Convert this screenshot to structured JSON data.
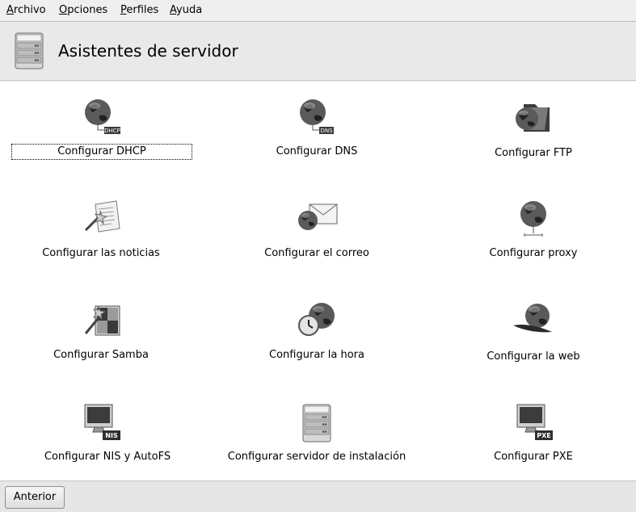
{
  "menubar": {
    "items": [
      {
        "label": "Archivo",
        "icon": null
      },
      {
        "label": "Opciones"
      },
      {
        "label": "Perfiles"
      },
      {
        "label": "Ayuda"
      }
    ]
  },
  "header": {
    "title": "Asistentes de servidor",
    "icon": "server-icon"
  },
  "wizards": [
    {
      "label": "Configurar DHCP",
      "icon": "globe-dhcp-icon",
      "focused": true
    },
    {
      "label": "Configurar DNS",
      "icon": "globe-dns-icon"
    },
    {
      "label": "Configurar FTP",
      "icon": "globe-folder-icon"
    },
    {
      "label": "Configurar las noticias",
      "icon": "news-wand-icon"
    },
    {
      "label": "Configurar el correo",
      "icon": "globe-mail-icon"
    },
    {
      "label": "Configurar proxy",
      "icon": "globe-network-icon"
    },
    {
      "label": "Configurar Samba",
      "icon": "samba-wand-icon"
    },
    {
      "label": "Configurar la hora",
      "icon": "globe-clock-icon"
    },
    {
      "label": "Configurar la web",
      "icon": "globe-feather-icon"
    },
    {
      "label": "Configurar NIS y AutoFS",
      "icon": "monitor-nis-icon"
    },
    {
      "label": "Configurar servidor de instalación",
      "icon": "server-icon"
    },
    {
      "label": "Configurar PXE",
      "icon": "monitor-pxe-icon"
    }
  ],
  "badges": {
    "dhcp": "DHCP",
    "dns": "DNS",
    "nis": "NIS",
    "pxe": "PXE"
  },
  "footer": {
    "back_label": "Anterior"
  }
}
